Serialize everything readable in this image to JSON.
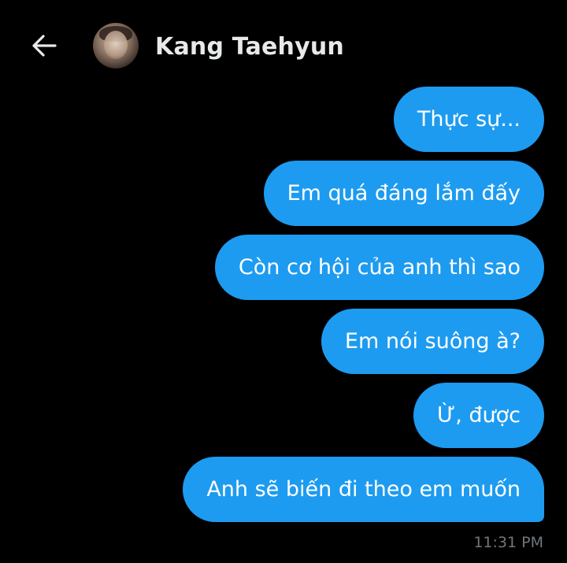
{
  "header": {
    "back_icon": "arrow-left-icon",
    "contact_name": "Kang Taehyun"
  },
  "colors": {
    "background": "#000000",
    "bubble": "#1d9bf0",
    "bubble_text": "#ffffff",
    "header_text": "#e7e9ea",
    "timestamp_text": "#71767b"
  },
  "messages": [
    {
      "text": "Thực sự..."
    },
    {
      "text": "Em quá đáng lắm đấy"
    },
    {
      "text": "Còn cơ hội của anh thì sao"
    },
    {
      "text": "Em nói suông à?"
    },
    {
      "text": "Ừ, được"
    },
    {
      "text": "Anh sẽ biến đi theo em muốn"
    }
  ],
  "timestamp": "11:31 PM"
}
